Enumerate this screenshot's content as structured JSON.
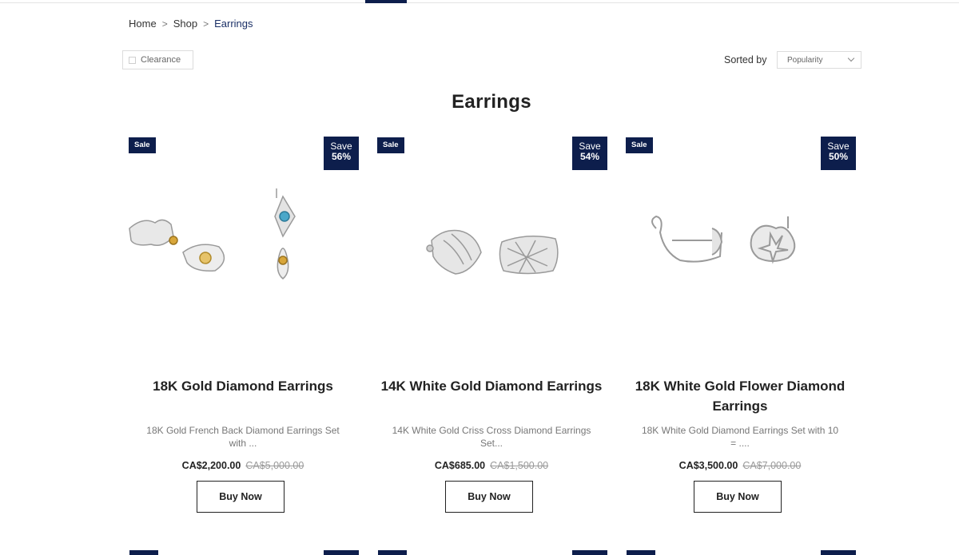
{
  "breadcrumb": {
    "home": "Home",
    "shop": "Shop",
    "current": "Earrings",
    "separator": ">"
  },
  "filter": {
    "clearance_label": "Clearance"
  },
  "sort": {
    "label": "Sorted by",
    "selected": "Popularity"
  },
  "page": {
    "title": "Earrings"
  },
  "colors": {
    "navy": "#0d1e4c",
    "link": "#1a2f66"
  },
  "products": [
    {
      "sale_badge": "Sale",
      "save_label": "Save",
      "save_pct": "56%",
      "name": "18K Gold Diamond Earrings",
      "description": "18K Gold French Back Diamond Earrings Set with ...",
      "price": "CA$2,200.00",
      "old_price": "CA$5,000.00",
      "button": "Buy Now"
    },
    {
      "sale_badge": "Sale",
      "save_label": "Save",
      "save_pct": "54%",
      "name": "14K White Gold Diamond Earrings",
      "description": "14K White Gold Criss Cross Diamond Earrings Set...",
      "price": "CA$685.00",
      "old_price": "CA$1,500.00",
      "button": "Buy Now"
    },
    {
      "sale_badge": "Sale",
      "save_label": "Save",
      "save_pct": "50%",
      "name": "18K White Gold Flower Diamond Earrings",
      "description": "18K White Gold Diamond Earrings Set with 10 = ....",
      "price": "CA$3,500.00",
      "old_price": "CA$7,000.00",
      "button": "Buy Now"
    }
  ]
}
